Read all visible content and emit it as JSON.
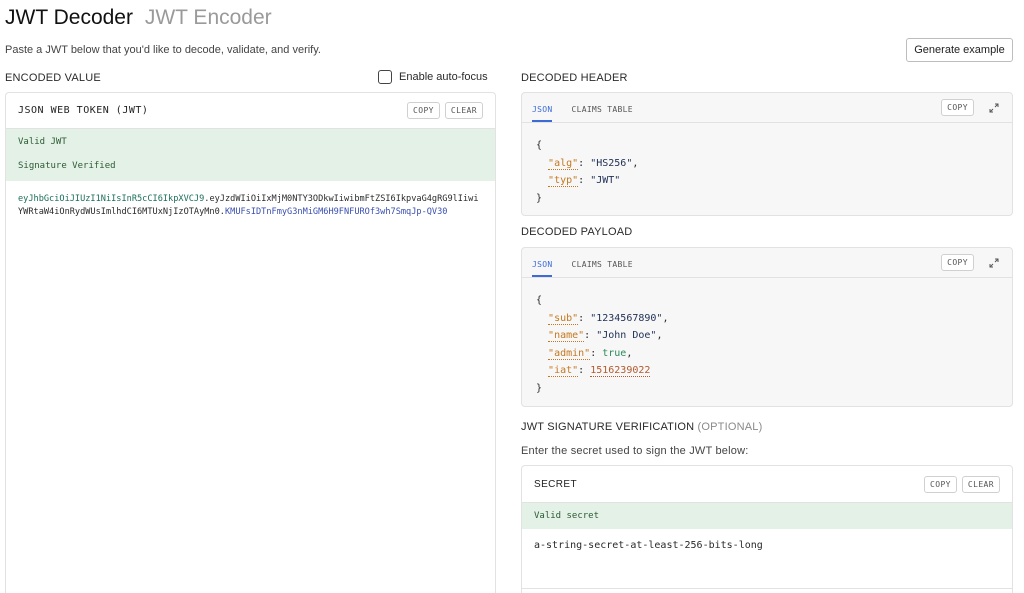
{
  "header": {
    "tab_decoder": "JWT Decoder",
    "tab_encoder": "JWT Encoder",
    "subtitle": "Paste a JWT below that you'd like to decode, validate, and verify.",
    "generate_btn": "Generate example"
  },
  "encoded": {
    "section_label": "ENCODED VALUE",
    "autofocus_label": "Enable auto-focus",
    "autofocus_checked": false,
    "panel_title": "JSON WEB TOKEN (JWT)",
    "copy": "COPY",
    "clear": "CLEAR",
    "status_valid": "Valid JWT",
    "status_signature": "Signature Verified",
    "token_header": "eyJhbGciOiJIUzI1NiIsInR5cCI6IkpXVCJ9",
    "token_payload": "eyJzdWIiOiIxMjM0NTY3ODkwIiwibmFtZSI6IkpvaG4gRG9lIiwiYWRtaW4iOnRydWUsImlhdCI6MTUxNjIzOTAyMn0",
    "token_signature": "KMUFsIDTnFmyG3nMiGM6H9FNFUROf3wh7SmqJp-QV30"
  },
  "decoded_header": {
    "section_label": "DECODED HEADER",
    "tab_json": "JSON",
    "tab_claims": "CLAIMS TABLE",
    "copy": "COPY",
    "open_brace": "{",
    "close_brace": "}",
    "alg_key": "\"alg\"",
    "alg_val": "\"HS256\"",
    "typ_key": "\"typ\"",
    "typ_val": "\"JWT\""
  },
  "decoded_payload": {
    "section_label": "DECODED PAYLOAD",
    "tab_json": "JSON",
    "tab_claims": "CLAIMS TABLE",
    "copy": "COPY",
    "open_brace": "{",
    "close_brace": "}",
    "sub_key": "\"sub\"",
    "sub_val": "\"1234567890\"",
    "name_key": "\"name\"",
    "name_val": "\"John Doe\"",
    "admin_key": "\"admin\"",
    "admin_val": "true",
    "iat_key": "\"iat\"",
    "iat_val": "1516239022"
  },
  "signature": {
    "section_label": "JWT SIGNATURE VERIFICATION",
    "optional": "(OPTIONAL)",
    "instruction": "Enter the secret used to sign the JWT below:",
    "panel_title": "SECRET",
    "copy": "COPY",
    "clear": "CLEAR",
    "status": "Valid secret",
    "secret_value": "a-string-secret-at-least-256-bits-long"
  },
  "colors": {
    "accent": "#3b6bd6",
    "valid_bg": "#e3f1e6",
    "valid_text": "#2c5b33",
    "json_key": "#c4781e",
    "json_bool": "#2d8a5a"
  },
  "icons": {
    "expand": "expand-icon"
  }
}
